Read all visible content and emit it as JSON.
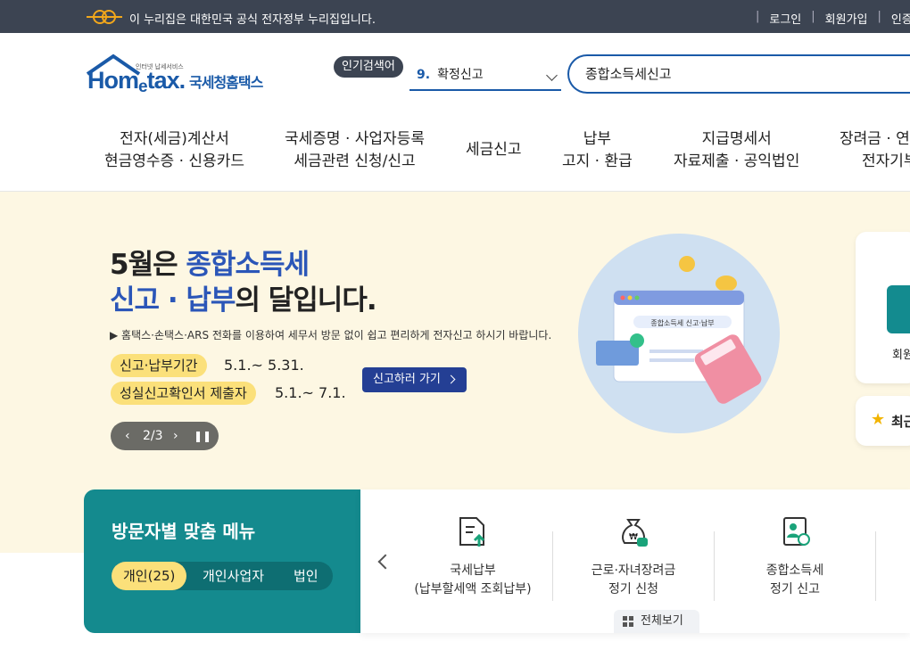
{
  "gov_bar": {
    "notice": "이 누리집은 대한민국 공식 전자정부 누리집입니다.",
    "links": [
      "로그인",
      "회원가입",
      "인증센"
    ]
  },
  "logo": {
    "tagline": "인터넷 납세서비스",
    "brand": "Hometax.",
    "brand_main": "Hom",
    "brand_e": "e",
    "brand_end": "tax.",
    "korean": "국세청홈택스"
  },
  "popular": {
    "badge": "인기검색어",
    "rank": "9.",
    "term": "확정신고"
  },
  "search": {
    "value": "종합소득세신고"
  },
  "gnb": [
    {
      "line1": "전자(세금)계산서",
      "line2": "현금영수증 · 신용카드"
    },
    {
      "line1": "국세증명 · 사업자등록",
      "line2": "세금관련 신청/신고"
    },
    {
      "line1": "세금신고",
      "line2": ""
    },
    {
      "line1": "납부",
      "line2": "고지 · 환급"
    },
    {
      "line1": "지급명세서",
      "line2": "자료제출 · 공익법인"
    },
    {
      "line1": "장려금 · 연",
      "line2": "전자기부"
    }
  ],
  "hero": {
    "line1_pre": "5월은 ",
    "line1_hl": "종합소득세",
    "line2_hl": "신고 · 납부",
    "line2_post": "의 달입니다.",
    "desc": "▶ 홈택스·손택스·ARS 전화를 이용하여 세무서 방문 없이 쉽고 편리하게 전자신고 하시기 바랍니다.",
    "period1_label": "신고·납부기간",
    "period1_date": "5.1.~ 5.31.",
    "period2_label": "성실신고확인서 제출자",
    "period2_date": "5.1.~ 7.1.",
    "cta": "신고하러 가기",
    "pager": "2/3",
    "illus_caption": "종합소득세 신고·납부"
  },
  "side": {
    "card_text": "회원",
    "recent": "최근"
  },
  "visitor": {
    "title": "방문자별 맞춤 메뉴",
    "tabs": [
      "개인(25)",
      "개인사업자",
      "법인"
    ]
  },
  "quick_menu": [
    {
      "line1": "국세납부",
      "line2": "(납부할세액 조회납부)"
    },
    {
      "line1": "근로·자녀장려금",
      "line2": "정기 신청"
    },
    {
      "line1": "종합소득세",
      "line2": "정기 신고"
    }
  ],
  "view_all": "전체보기",
  "colors": {
    "primary": "#1a5aa8",
    "gov_bar": "#3c4452",
    "hero_bg": "#fdf7e3",
    "highlight": "#fbe07a",
    "teal": "#148a8e",
    "cta": "#243f94"
  }
}
